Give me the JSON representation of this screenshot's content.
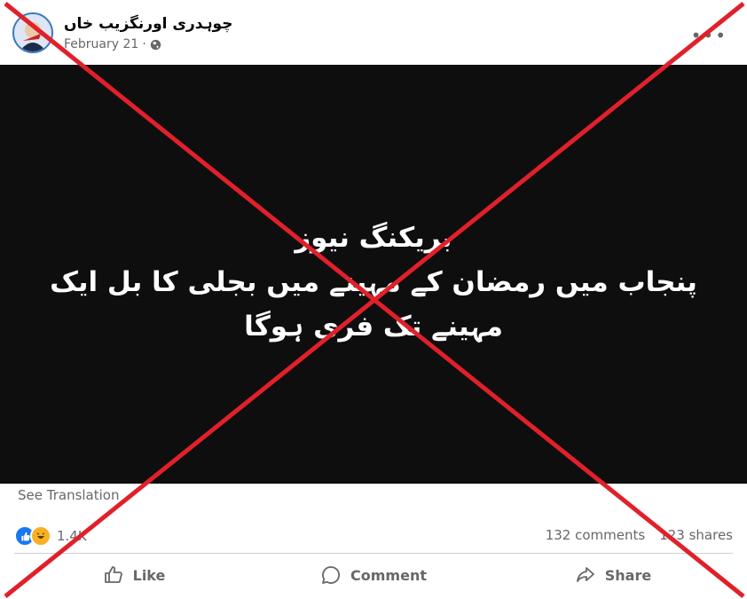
{
  "post": {
    "author": "چوہدری اورنگزیب خاں",
    "date": "February 21",
    "date_separator": "·",
    "more_label": "•••",
    "image_text": {
      "line1": "بریکنگ نیوز",
      "line2": "پنجاب میں رمضان کے مہینے میں بجلی کا بل ایک",
      "line3": "مہینے تک فری ہوگا"
    },
    "see_translation": "See Translation",
    "reactions_count": "1.4K",
    "comments": "132 comments",
    "shares": "123 shares"
  },
  "actions": {
    "like": "Like",
    "comment": "Comment",
    "share": "Share"
  },
  "colors": {
    "cross": "#e0202a",
    "facebook_blue": "#1877f2",
    "muted": "#65676b"
  }
}
